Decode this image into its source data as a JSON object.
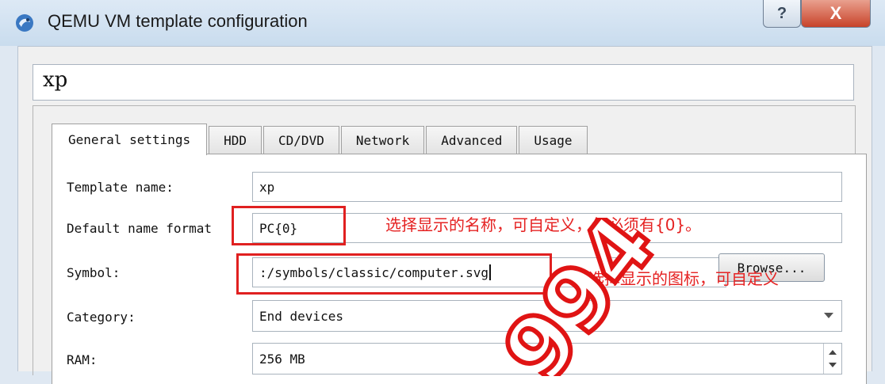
{
  "window": {
    "title": "QEMU VM template configuration",
    "help_label": "?",
    "close_label": "X"
  },
  "header": {
    "template_display_name": "xp"
  },
  "tabs": [
    {
      "label": "General settings",
      "active": true
    },
    {
      "label": "HDD",
      "active": false
    },
    {
      "label": "CD/DVD",
      "active": false
    },
    {
      "label": "Network",
      "active": false
    },
    {
      "label": "Advanced",
      "active": false
    },
    {
      "label": "Usage",
      "active": false
    }
  ],
  "form": {
    "template_name": {
      "label": "Template name:",
      "value": "xp"
    },
    "default_name_format": {
      "label": "Default name format",
      "value": "PC{0}"
    },
    "symbol": {
      "label": "Symbol:",
      "value": ":/symbols/classic/computer.svg",
      "browse_label": "Browse..."
    },
    "category": {
      "label": "Category:",
      "value": "End devices"
    },
    "ram": {
      "label": "RAM:",
      "value": "256 MB"
    }
  },
  "annotations": {
    "name_note": "选择显示的名称，可自定义，但必须有{0}。",
    "symbol_note": "选择显示的图标，可自定义",
    "color": "#e52222"
  },
  "watermark": {
    "text": "994"
  }
}
